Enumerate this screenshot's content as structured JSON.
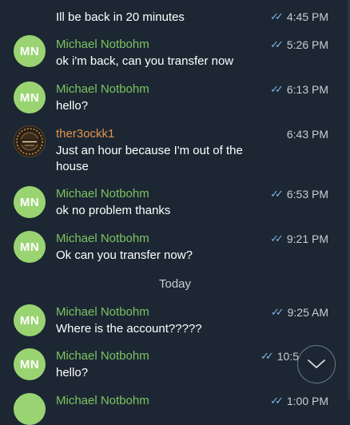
{
  "messages": [
    {
      "sender": "",
      "text": "Ill be back in 20 minutes",
      "time": "4:45 PM",
      "read": true
    },
    {
      "sender": "Michael Notbohm",
      "avatar": "MN",
      "text": "ok i'm back, can you transfer now",
      "time": "5:26 PM",
      "read": true
    },
    {
      "sender": "Michael Notbohm",
      "avatar": "MN",
      "text": "hello?",
      "time": "6:13 PM",
      "read": true
    },
    {
      "sender": "ther3ockk1",
      "avatar_image": "GOOHK",
      "text": "Just an hour because I'm out of the house",
      "time": "6:43 PM",
      "read": false
    },
    {
      "sender": "Michael Notbohm",
      "avatar": "MN",
      "text": "ok no problem thanks",
      "time": "6:53 PM",
      "read": true
    },
    {
      "sender": "Michael Notbohm",
      "avatar": "MN",
      "text": "Ok can you transfer now?",
      "time": "9:21 PM",
      "read": true
    },
    {
      "sender": "Michael Notbohm",
      "avatar": "MN",
      "text": "Where is the account?????",
      "time": "9:25 AM",
      "read": true
    },
    {
      "sender": "Michael Notbohm",
      "avatar": "MN",
      "text": "hello?",
      "time": "10:5",
      "read": true
    },
    {
      "sender": "Michael Notbohm",
      "avatar": "",
      "text": "",
      "time": "1:00 PM",
      "read": true
    }
  ],
  "day_separator": "Today",
  "icons": {
    "read_receipt": "double-check-icon",
    "scroll": "chevron-down-icon"
  },
  "colors": {
    "background": "#1c2733",
    "sender_green": "#7ec361",
    "sender_orange": "#e0944c",
    "check": "#7db4e8",
    "avatar": "#9ad472"
  }
}
